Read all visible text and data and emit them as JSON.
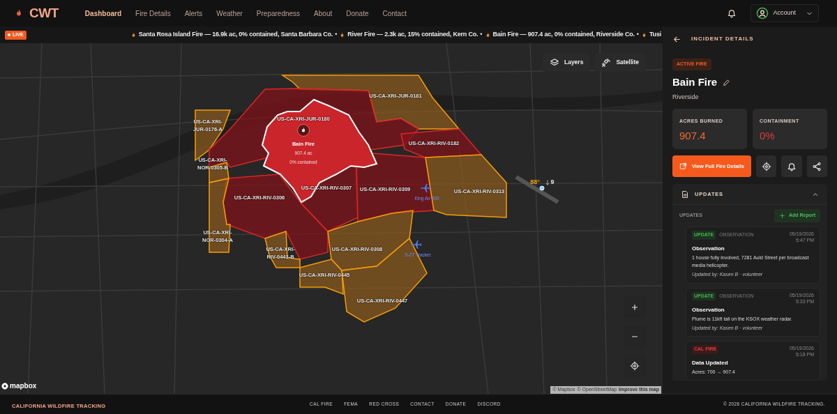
{
  "nav": {
    "logo": "CWT",
    "links": [
      {
        "label": "Dashboard",
        "selected": true
      },
      {
        "label": "Fire Details",
        "selected": false
      },
      {
        "label": "Alerts",
        "selected": false
      },
      {
        "label": "Weather",
        "selected": false
      },
      {
        "label": "Preparedness",
        "selected": false
      },
      {
        "label": "About",
        "selected": false
      },
      {
        "label": "Donate",
        "selected": false
      },
      {
        "label": "Contact",
        "selected": false
      }
    ],
    "account": "Account"
  },
  "ticker": {
    "live": "LIVE",
    "separator": "•",
    "items": [
      "Santa Rosa Island Fire — 16.9k ac, 0% contained, Santa Barbara Co.",
      "River Fire — 2.3k ac, 15% contained, Kern Co.",
      "Bain Fire — 907.4 ac, 0% contained, Riverside Co.",
      "Tusi"
    ]
  },
  "map": {
    "controls": [
      "Layers",
      "Satellite"
    ],
    "zones": [
      {
        "label": "US-CA-XRI-JUR-0181",
        "kind": "warning"
      },
      {
        "label": "US-CA-XRI-JUR-0176-A",
        "kind": "warning"
      },
      {
        "label": "US-CA-XRI-JUR-0180",
        "kind": "order"
      },
      {
        "label": "US-CA-XRI-RIV-0182",
        "kind": "order"
      },
      {
        "label": "US-CA-XRI-NOR-0305-B",
        "kind": "warning"
      },
      {
        "label": "US-CA-XRI-RIV-0306",
        "kind": "order"
      },
      {
        "label": "US-CA-XRI-RIV-0307",
        "kind": "order"
      },
      {
        "label": "US-CA-XRI-RIV-0309",
        "kind": "order"
      },
      {
        "label": "US-CA-XRI-RIV-0313",
        "kind": "warning"
      },
      {
        "label": "US-CA-XRI-NOR-0304-A",
        "kind": "warning"
      },
      {
        "label": "US-CA-XRI-RIV-0443-B",
        "kind": "warning"
      },
      {
        "label": "US-CA-XRI-RIV-0308",
        "kind": "warning"
      },
      {
        "label": "US-CA-XRI-RIV-0445",
        "kind": "warning"
      },
      {
        "label": "US-CA-XRI-RIV-0447",
        "kind": "warning"
      }
    ],
    "fire": {
      "name": "Bain Fire",
      "acres": "907.4 ac",
      "contained": "0% contained"
    },
    "aircraft": [
      "King Air 200",
      "S-2T Tracker"
    ],
    "weather": {
      "temp": "88°",
      "wind": "9"
    },
    "logo": "mapbox",
    "attribution": [
      "© Mapbox",
      "© OpenStreetMap",
      "Improve this map"
    ]
  },
  "panel": {
    "title": "INCIDENT DETAILS",
    "status": "ACTIVE FIRE",
    "name": "Bain Fire",
    "location": "Riverside",
    "stats": [
      {
        "label": "ACRES BURNED",
        "value": "907.4"
      },
      {
        "label": "CONTAINMENT",
        "value": "0%"
      }
    ],
    "primary_button": "View Full Fire Details",
    "updates": {
      "title": "UPDATES",
      "expanded": true,
      "sublabel": "UPDATES",
      "add": "Add Report",
      "items": [
        {
          "tag": "UPDATE",
          "kind": "update",
          "category": "OBSERVATION",
          "date": "05/19/2026",
          "time": "5:47 PM",
          "title": "Observation",
          "body": "1 house fully involved, 7281 Auld Street per broadcast media helicopter.",
          "author": "Updated by: Kasen B · volunteer"
        },
        {
          "tag": "UPDATE",
          "kind": "update",
          "category": "OBSERVATION",
          "date": "05/19/2026",
          "time": "5:33 PM",
          "title": "Observation",
          "body": "Plume is 11kft tall on the KSOX weather radar.",
          "author": "Updated by: Kasen B · volunteer"
        },
        {
          "tag": "CAL FIRE",
          "kind": "calfire",
          "date": "05/19/2026",
          "time": "5:18 PM",
          "title": "Data Updated",
          "body": "Acres: 700 → 907.4"
        }
      ]
    }
  },
  "footer": {
    "brand": "CALIFORNIA WILDFIRE TRACKING",
    "links": [
      "CAL FIRE",
      "FEMA",
      "RED CROSS",
      "CONTACT",
      "DONATE",
      "DISCORD"
    ],
    "copyright": "© 2026 CALIFORNIA WILDFIRE TRACKING."
  }
}
